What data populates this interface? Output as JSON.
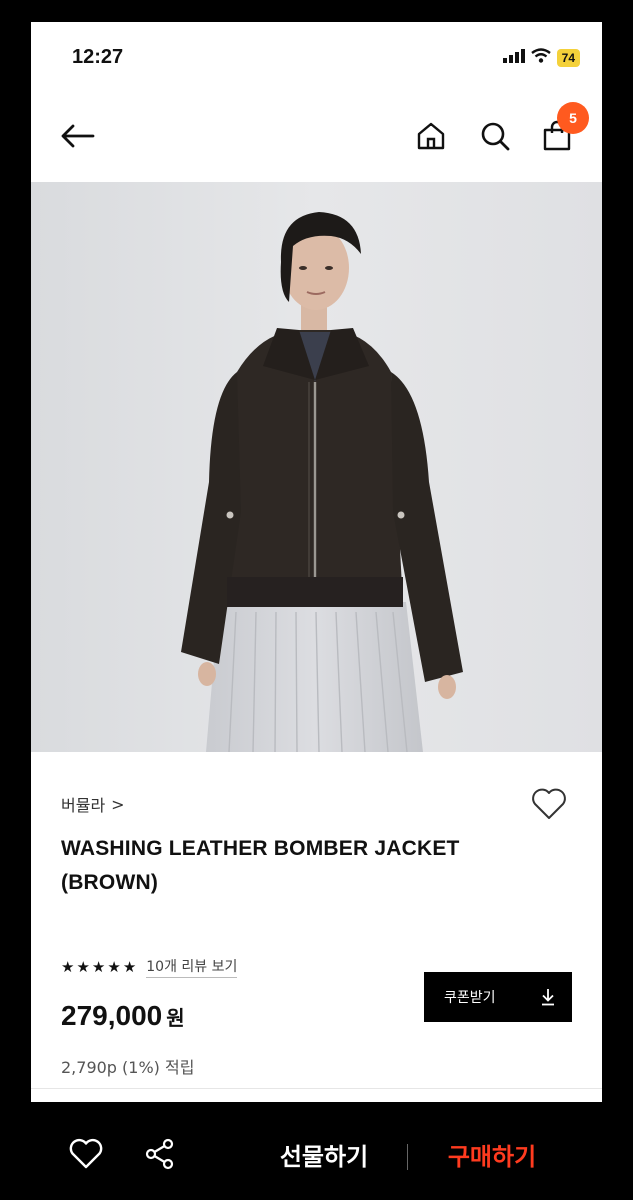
{
  "status_bar": {
    "time": "12:27",
    "battery": "74",
    "icons": [
      "signal-icon",
      "wifi-icon",
      "battery-icon"
    ]
  },
  "nav": {
    "icons": [
      "back-arrow-icon",
      "home-icon",
      "search-icon",
      "shopping-bag-icon"
    ],
    "cart_badge": "5"
  },
  "product": {
    "brand": "버뮬라",
    "brand_chevron": ">",
    "title": "WASHING LEATHER BOMBER JACKET (BROWN)",
    "rating_stars": 5,
    "review_link": "10개 리뷰 보기",
    "price": "279,000",
    "currency": "원",
    "points": "2,790p (1%) 적립",
    "coupon_label": "쿠폰받기"
  },
  "bottom_bar": {
    "gift_label": "선물하기",
    "buy_label": "구매하기"
  },
  "colors": {
    "accent": "#ff5a1f",
    "buy": "#ff3b1f",
    "image_bg": "#e2e3e5"
  }
}
